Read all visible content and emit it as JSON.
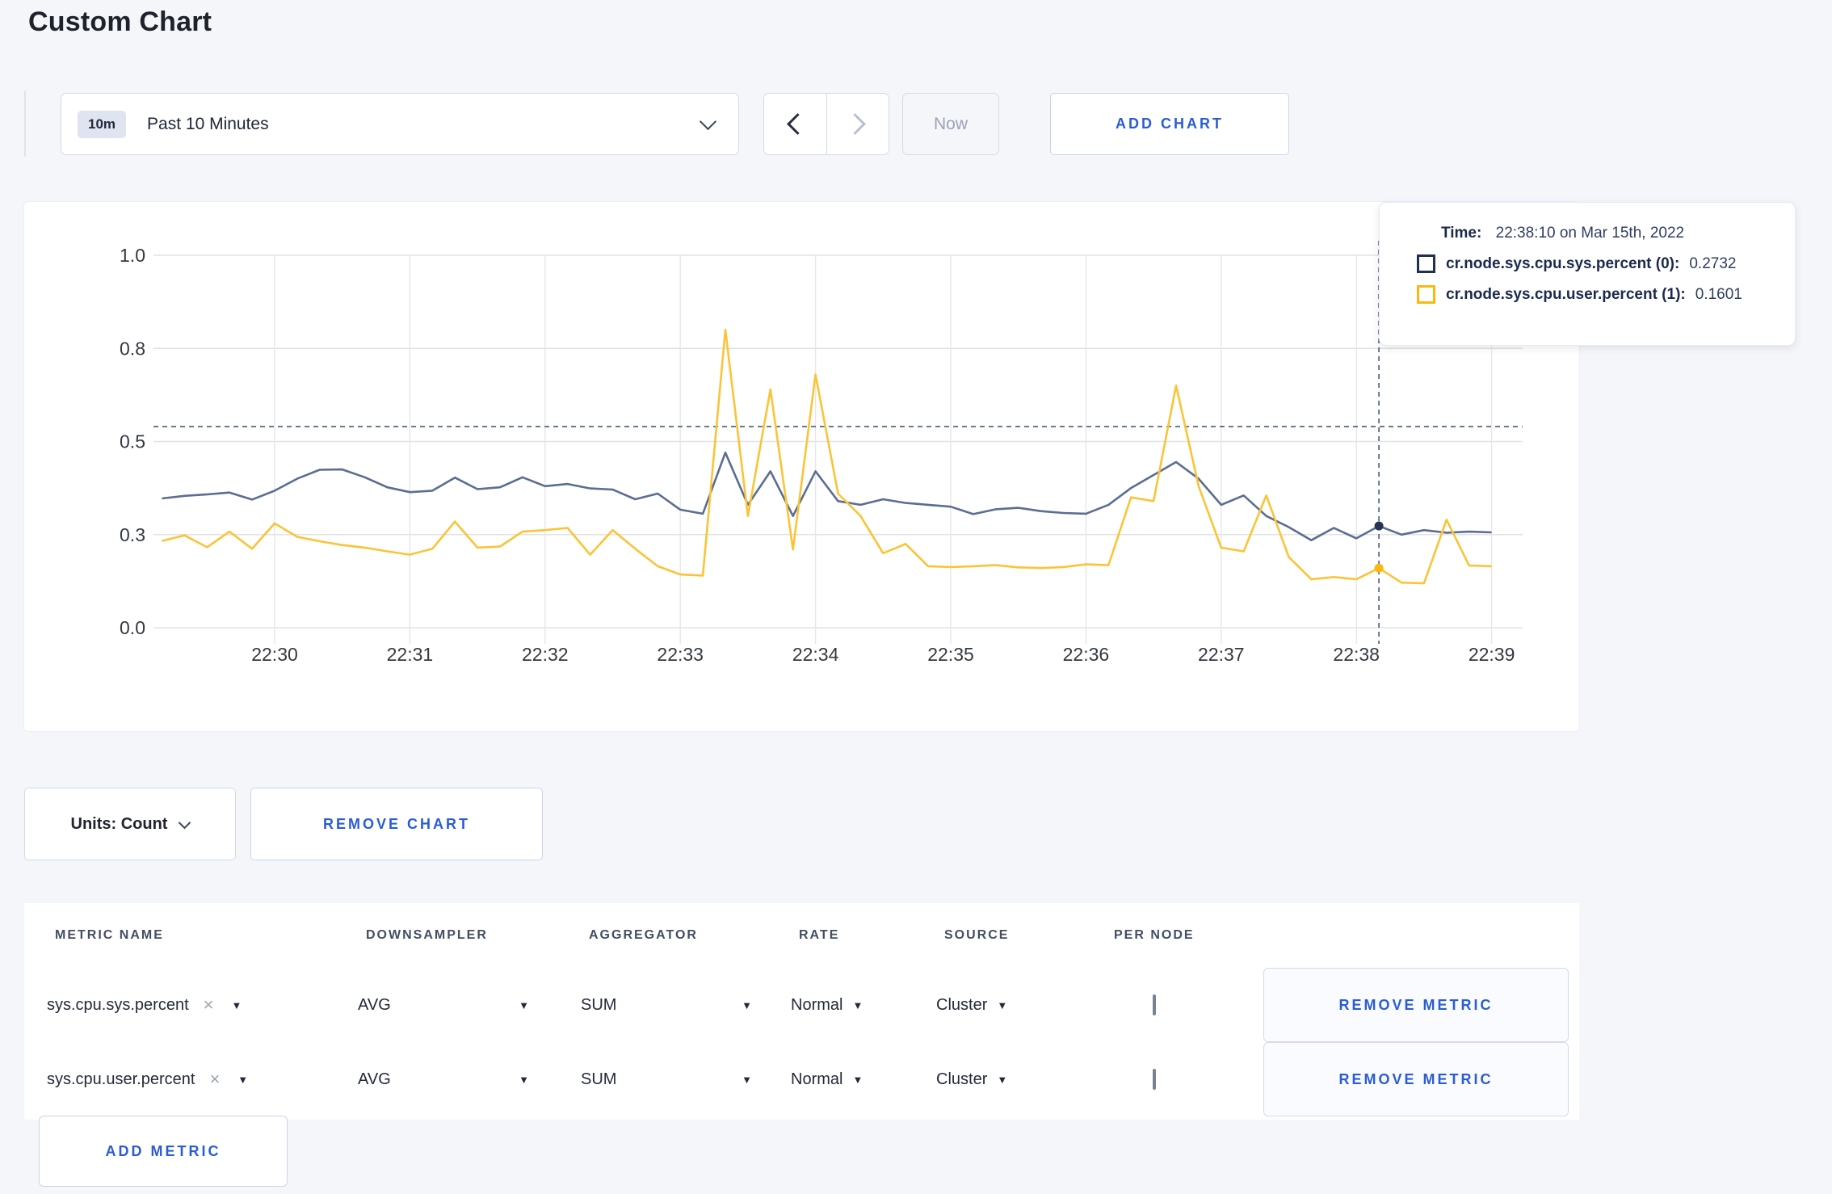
{
  "page": {
    "title": "Custom Chart"
  },
  "toolbar": {
    "time_range": {
      "badge": "10m",
      "label": "Past 10 Minutes"
    },
    "now_label": "Now",
    "add_chart_label": "ADD CHART"
  },
  "icons": {
    "caret_down": "▼",
    "clear": "×"
  },
  "tooltip": {
    "time_label": "Time:",
    "time_value": "22:38:10 on Mar 15th, 2022",
    "series": [
      {
        "label": "cr.node.sys.cpu.sys.percent (0):",
        "value": "0.2732",
        "color": "#22304f"
      },
      {
        "label": "cr.node.sys.cpu.user.percent (1):",
        "value": "0.1601",
        "color": "#fcb80f"
      }
    ]
  },
  "units_row": {
    "units_label": "Units: Count",
    "remove_chart_label": "REMOVE CHART"
  },
  "metrics_table": {
    "headers": [
      "METRIC NAME",
      "DOWNSAMPLER",
      "AGGREGATOR",
      "RATE",
      "SOURCE",
      "PER NODE"
    ],
    "rows": [
      {
        "metric": "sys.cpu.sys.percent",
        "downsampler": "AVG",
        "aggregator": "SUM",
        "rate": "Normal",
        "source": "Cluster",
        "per_node": false,
        "remove_label": "REMOVE METRIC"
      },
      {
        "metric": "sys.cpu.user.percent",
        "downsampler": "AVG",
        "aggregator": "SUM",
        "rate": "Normal",
        "source": "Cluster",
        "per_node": false,
        "remove_label": "REMOVE METRIC"
      }
    ],
    "add_metric_label": "ADD METRIC"
  },
  "chart_data": {
    "type": "line",
    "title": "",
    "xlabel": "",
    "ylabel": "",
    "ylim": [
      0,
      1
    ],
    "grid": true,
    "legend_position": "tooltip",
    "x_ticks": [
      "22:30",
      "22:31",
      "22:32",
      "22:33",
      "22:34",
      "22:35",
      "22:36",
      "22:37",
      "22:38",
      "22:39"
    ],
    "y_tick_labels": [
      "0.0",
      "0.3",
      "0.5",
      "0.8",
      "1.0"
    ],
    "y_tick_values": [
      0,
      0.25,
      0.5,
      0.75,
      1.0
    ],
    "start_time": "22:29:10",
    "step_seconds": 10,
    "first_sample_offset_seconds": -50,
    "crosshair": {
      "time": "22:38:10",
      "seconds_after_22_30": 490,
      "y_value": 0.54,
      "color": "#47597a"
    },
    "series": [
      {
        "name": "cr.node.sys.cpu.sys.percent",
        "color": "#5b6d90",
        "dot_color": "#26354f",
        "crosshair_value": 0.2732,
        "values": [
          0.347,
          0.354,
          0.358,
          0.363,
          0.344,
          0.368,
          0.4,
          0.424,
          0.425,
          0.404,
          0.377,
          0.364,
          0.368,
          0.403,
          0.372,
          0.377,
          0.404,
          0.38,
          0.386,
          0.374,
          0.371,
          0.345,
          0.36,
          0.317,
          0.306,
          0.47,
          0.33,
          0.42,
          0.3,
          0.42,
          0.34,
          0.33,
          0.345,
          0.335,
          0.33,
          0.325,
          0.305,
          0.318,
          0.322,
          0.313,
          0.308,
          0.306,
          0.33,
          0.375,
          0.41,
          0.445,
          0.4,
          0.33,
          0.355,
          0.3,
          0.27,
          0.235,
          0.268,
          0.24,
          0.2732,
          0.25,
          0.262,
          0.255,
          0.258,
          0.256
        ]
      },
      {
        "name": "cr.node.sys.cpu.user.percent",
        "color": "#fbc437",
        "dot_color": "#fcb80f",
        "crosshair_value": 0.1601,
        "values": [
          0.233,
          0.248,
          0.216,
          0.258,
          0.212,
          0.28,
          0.244,
          0.232,
          0.222,
          0.215,
          0.205,
          0.196,
          0.212,
          0.285,
          0.215,
          0.218,
          0.258,
          0.262,
          0.268,
          0.196,
          0.262,
          0.212,
          0.165,
          0.143,
          0.14,
          0.8,
          0.3,
          0.64,
          0.21,
          0.68,
          0.36,
          0.3,
          0.2,
          0.225,
          0.165,
          0.163,
          0.165,
          0.168,
          0.162,
          0.16,
          0.163,
          0.17,
          0.168,
          0.35,
          0.34,
          0.65,
          0.38,
          0.215,
          0.205,
          0.355,
          0.19,
          0.13,
          0.136,
          0.13,
          0.1601,
          0.121,
          0.119,
          0.29,
          0.167,
          0.165
        ]
      }
    ]
  }
}
